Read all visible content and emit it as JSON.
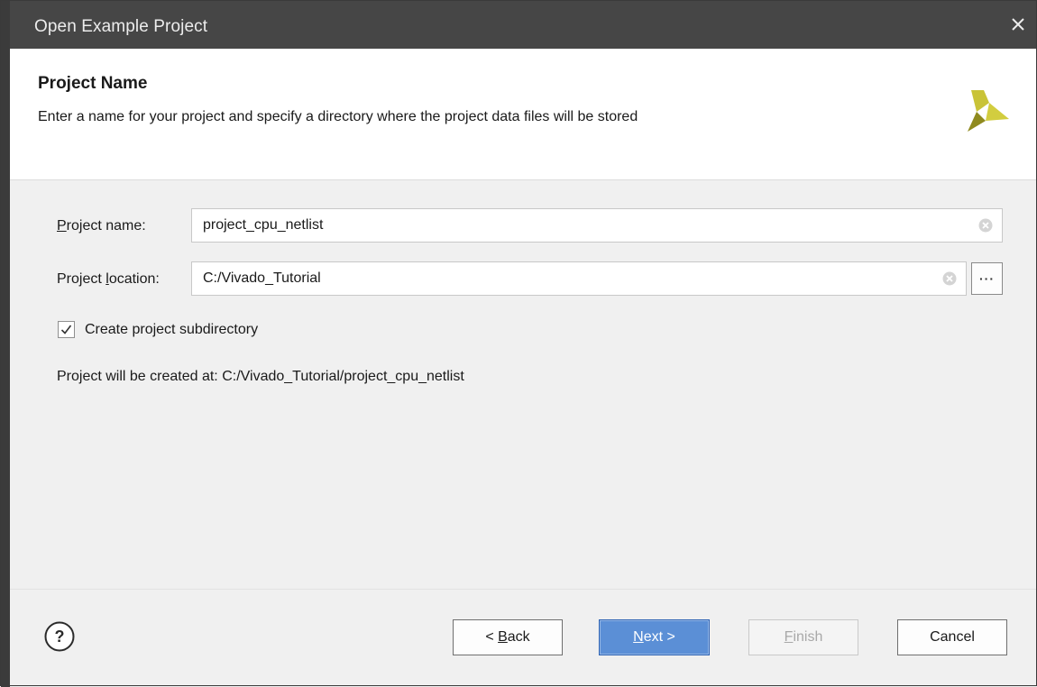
{
  "window": {
    "title": "Open Example Project"
  },
  "header": {
    "title": "Project Name",
    "description": "Enter a name for your project and specify a directory where the project data files will be stored"
  },
  "form": {
    "project_name": {
      "label_mnemonic": "P",
      "label_rest": "roject name:",
      "value": "project_cpu_netlist"
    },
    "project_location": {
      "label_before": "Project ",
      "label_mnemonic": "l",
      "label_after": "ocation:",
      "value": "C:/Vivado_Tutorial",
      "browse_label": "···"
    },
    "create_subdirectory": {
      "label": "Create project subdirectory",
      "checked": true
    },
    "created_at_text": "Project will be created at: C:/Vivado_Tutorial/project_cpu_netlist"
  },
  "footer": {
    "help_label": "?",
    "back": {
      "prefix": "< ",
      "mnemonic": "B",
      "rest": "ack"
    },
    "next": {
      "mnemonic": "N",
      "rest": "ext >"
    },
    "finish": {
      "mnemonic": "F",
      "rest": "inish"
    },
    "cancel": {
      "label": "Cancel"
    }
  },
  "colors": {
    "titlebar": "#464646",
    "accent": "#5b8fd6",
    "logo_light": "#c9c337",
    "logo_dark": "#8f8a1e"
  }
}
